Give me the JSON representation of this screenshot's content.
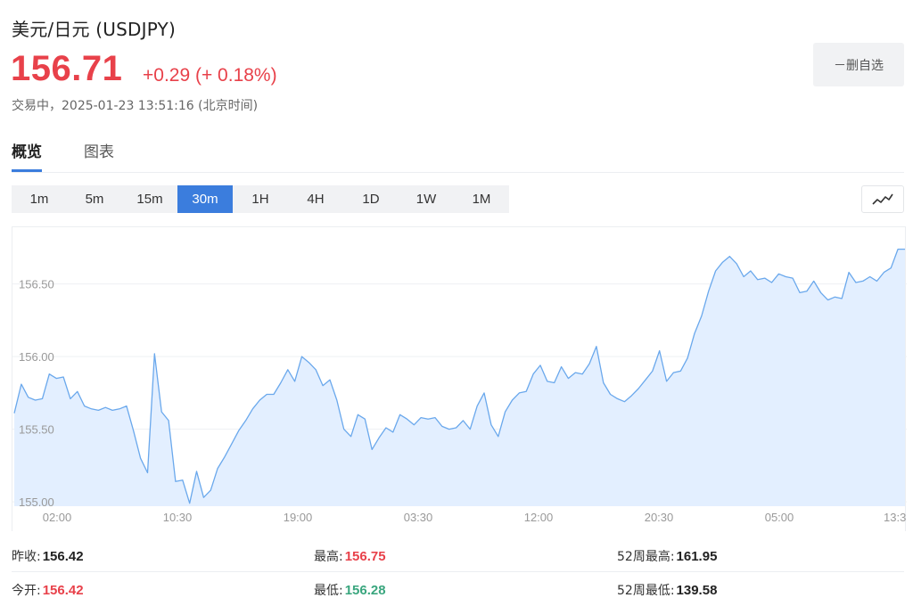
{
  "header": {
    "title": "美元/日元 (USDJPY)",
    "price": "156.71",
    "change": "+0.29 (+ 0.18%)",
    "status": "交易中，2025-01-23 13:51:16 (北京时间)",
    "fav_label": "－删自选"
  },
  "tabs": [
    {
      "label": "概览",
      "active": true
    },
    {
      "label": "图表",
      "active": false
    }
  ],
  "periods": [
    {
      "label": "1m"
    },
    {
      "label": "5m"
    },
    {
      "label": "15m"
    },
    {
      "label": "30m",
      "active": true
    },
    {
      "label": "1H"
    },
    {
      "label": "4H"
    },
    {
      "label": "1D"
    },
    {
      "label": "1W"
    },
    {
      "label": "1M"
    }
  ],
  "chart_type_icon": "line-chart-icon",
  "colors": {
    "up": "#e8414a",
    "down": "#3aa67e",
    "accent": "#3b7ddd",
    "line": "#6aa8ec",
    "fill": "#e3efff"
  },
  "chart_data": {
    "type": "area",
    "xlabel": "",
    "ylabel": "",
    "ylim": [
      154.97,
      156.86
    ],
    "y_ticks": [
      155.0,
      155.5,
      156.0,
      156.5
    ],
    "y_tick_labels": [
      "155.00",
      "155.50",
      "156.00",
      "156.50"
    ],
    "x_tick_labels": [
      "02:00",
      "10:30",
      "19:00",
      "03:30",
      "12:00",
      "20:30",
      "05:00",
      "13:3"
    ],
    "grid": true,
    "legend": "none",
    "values": [
      155.61,
      155.81,
      155.72,
      155.7,
      155.71,
      155.88,
      155.85,
      155.86,
      155.71,
      155.76,
      155.66,
      155.64,
      155.63,
      155.65,
      155.63,
      155.64,
      155.66,
      155.49,
      155.3,
      155.2,
      156.02,
      155.62,
      155.56,
      155.14,
      155.15,
      154.99,
      155.21,
      155.03,
      155.08,
      155.23,
      155.31,
      155.4,
      155.49,
      155.56,
      155.64,
      155.7,
      155.74,
      155.74,
      155.82,
      155.91,
      155.83,
      156.0,
      155.96,
      155.91,
      155.8,
      155.84,
      155.7,
      155.5,
      155.45,
      155.6,
      155.57,
      155.36,
      155.44,
      155.51,
      155.48,
      155.6,
      155.57,
      155.53,
      155.58,
      155.57,
      155.58,
      155.52,
      155.5,
      155.51,
      155.56,
      155.5,
      155.66,
      155.75,
      155.53,
      155.45,
      155.62,
      155.7,
      155.75,
      155.76,
      155.88,
      155.94,
      155.83,
      155.82,
      155.93,
      155.85,
      155.89,
      155.88,
      155.95,
      156.07,
      155.82,
      155.74,
      155.71,
      155.69,
      155.73,
      155.78,
      155.84,
      155.9,
      156.04,
      155.83,
      155.89,
      155.9,
      155.99,
      156.16,
      156.28,
      156.45,
      156.59,
      156.65,
      156.69,
      156.64,
      156.55,
      156.59,
      156.53,
      156.54,
      156.51,
      156.57,
      156.55,
      156.54,
      156.44,
      156.45,
      156.52,
      156.44,
      156.39,
      156.41,
      156.4,
      156.58,
      156.51,
      156.52,
      156.55,
      156.52,
      156.58,
      156.61,
      156.74,
      156.74
    ]
  },
  "stats": {
    "row1": [
      {
        "label": "昨收:",
        "value": "156.42",
        "color": "#222222"
      },
      {
        "label": "最高:",
        "value": "156.75",
        "color": "#e8414a"
      },
      {
        "label": "52周最高:",
        "value": "161.95",
        "color": "#222222"
      }
    ],
    "row2": [
      {
        "label": "今开:",
        "value": "156.42",
        "color": "#e8414a"
      },
      {
        "label": "最低:",
        "value": "156.28",
        "color": "#3aa67e"
      },
      {
        "label": "52周最低:",
        "value": "139.58",
        "color": "#222222"
      }
    ]
  }
}
